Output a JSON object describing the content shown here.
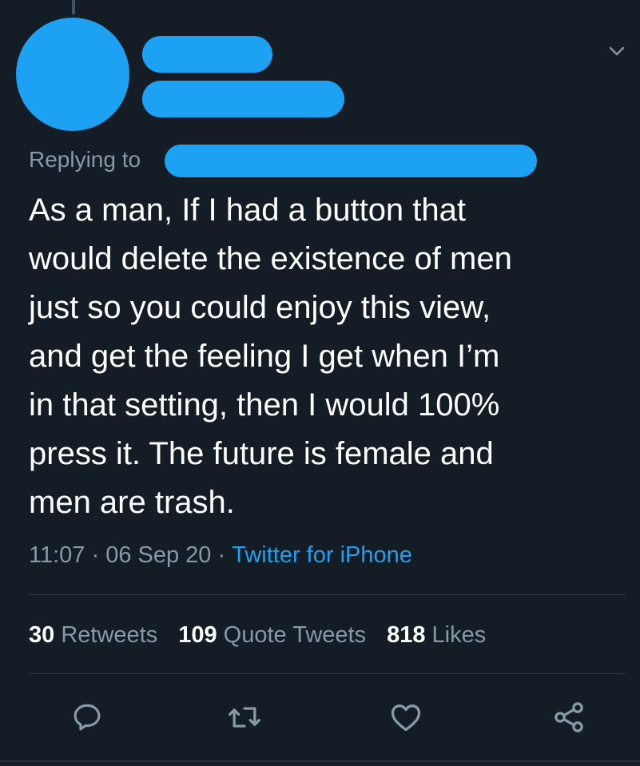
{
  "reply": {
    "prefix": "Replying to"
  },
  "tweet": {
    "text": "As a man, If I had a button that\nwould delete the existence of men\njust so you could enjoy this view,\nand get the feeling I get when I’m\nin that setting, then I would 100%\npress it. The future is female and\nmen are trash."
  },
  "meta": {
    "time": "11:07",
    "sep1": " · ",
    "date": "06 Sep 20",
    "sep2": " · ",
    "source": "Twitter for iPhone"
  },
  "stats": {
    "retweets_count": "30",
    "retweets_label": "Retweets",
    "quotes_count": "109",
    "quotes_label": "Quote Tweets",
    "likes_count": "818",
    "likes_label": "Likes"
  },
  "icons": {
    "menu": "chevron-down-icon",
    "reply": "reply-icon",
    "retweet": "retweet-icon",
    "like": "heart-icon",
    "share": "share-icon"
  },
  "colors": {
    "background": "#141d26",
    "accent": "#1da1f2",
    "secondary_text": "#8899a6",
    "divider": "#2b3945"
  }
}
